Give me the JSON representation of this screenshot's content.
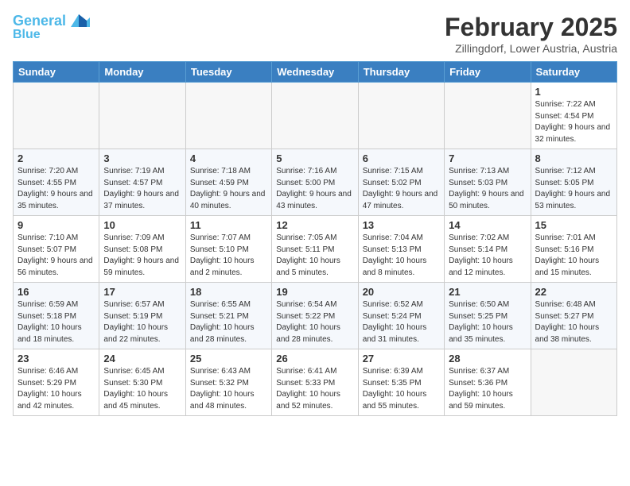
{
  "header": {
    "logo_line1": "General",
    "logo_line2": "Blue",
    "month": "February 2025",
    "location": "Zillingdorf, Lower Austria, Austria"
  },
  "weekdays": [
    "Sunday",
    "Monday",
    "Tuesday",
    "Wednesday",
    "Thursday",
    "Friday",
    "Saturday"
  ],
  "weeks": [
    [
      {
        "day": "",
        "info": ""
      },
      {
        "day": "",
        "info": ""
      },
      {
        "day": "",
        "info": ""
      },
      {
        "day": "",
        "info": ""
      },
      {
        "day": "",
        "info": ""
      },
      {
        "day": "",
        "info": ""
      },
      {
        "day": "1",
        "info": "Sunrise: 7:22 AM\nSunset: 4:54 PM\nDaylight: 9 hours and 32 minutes."
      }
    ],
    [
      {
        "day": "2",
        "info": "Sunrise: 7:20 AM\nSunset: 4:55 PM\nDaylight: 9 hours and 35 minutes."
      },
      {
        "day": "3",
        "info": "Sunrise: 7:19 AM\nSunset: 4:57 PM\nDaylight: 9 hours and 37 minutes."
      },
      {
        "day": "4",
        "info": "Sunrise: 7:18 AM\nSunset: 4:59 PM\nDaylight: 9 hours and 40 minutes."
      },
      {
        "day": "5",
        "info": "Sunrise: 7:16 AM\nSunset: 5:00 PM\nDaylight: 9 hours and 43 minutes."
      },
      {
        "day": "6",
        "info": "Sunrise: 7:15 AM\nSunset: 5:02 PM\nDaylight: 9 hours and 47 minutes."
      },
      {
        "day": "7",
        "info": "Sunrise: 7:13 AM\nSunset: 5:03 PM\nDaylight: 9 hours and 50 minutes."
      },
      {
        "day": "8",
        "info": "Sunrise: 7:12 AM\nSunset: 5:05 PM\nDaylight: 9 hours and 53 minutes."
      }
    ],
    [
      {
        "day": "9",
        "info": "Sunrise: 7:10 AM\nSunset: 5:07 PM\nDaylight: 9 hours and 56 minutes."
      },
      {
        "day": "10",
        "info": "Sunrise: 7:09 AM\nSunset: 5:08 PM\nDaylight: 9 hours and 59 minutes."
      },
      {
        "day": "11",
        "info": "Sunrise: 7:07 AM\nSunset: 5:10 PM\nDaylight: 10 hours and 2 minutes."
      },
      {
        "day": "12",
        "info": "Sunrise: 7:05 AM\nSunset: 5:11 PM\nDaylight: 10 hours and 5 minutes."
      },
      {
        "day": "13",
        "info": "Sunrise: 7:04 AM\nSunset: 5:13 PM\nDaylight: 10 hours and 8 minutes."
      },
      {
        "day": "14",
        "info": "Sunrise: 7:02 AM\nSunset: 5:14 PM\nDaylight: 10 hours and 12 minutes."
      },
      {
        "day": "15",
        "info": "Sunrise: 7:01 AM\nSunset: 5:16 PM\nDaylight: 10 hours and 15 minutes."
      }
    ],
    [
      {
        "day": "16",
        "info": "Sunrise: 6:59 AM\nSunset: 5:18 PM\nDaylight: 10 hours and 18 minutes."
      },
      {
        "day": "17",
        "info": "Sunrise: 6:57 AM\nSunset: 5:19 PM\nDaylight: 10 hours and 22 minutes."
      },
      {
        "day": "18",
        "info": "Sunrise: 6:55 AM\nSunset: 5:21 PM\nDaylight: 10 hours and 28 minutes."
      },
      {
        "day": "19",
        "info": "Sunrise: 6:54 AM\nSunset: 5:22 PM\nDaylight: 10 hours and 28 minutes."
      },
      {
        "day": "20",
        "info": "Sunrise: 6:52 AM\nSunset: 5:24 PM\nDaylight: 10 hours and 31 minutes."
      },
      {
        "day": "21",
        "info": "Sunrise: 6:50 AM\nSunset: 5:25 PM\nDaylight: 10 hours and 35 minutes."
      },
      {
        "day": "22",
        "info": "Sunrise: 6:48 AM\nSunset: 5:27 PM\nDaylight: 10 hours and 38 minutes."
      }
    ],
    [
      {
        "day": "23",
        "info": "Sunrise: 6:46 AM\nSunset: 5:29 PM\nDaylight: 10 hours and 42 minutes."
      },
      {
        "day": "24",
        "info": "Sunrise: 6:45 AM\nSunset: 5:30 PM\nDaylight: 10 hours and 45 minutes."
      },
      {
        "day": "25",
        "info": "Sunrise: 6:43 AM\nSunset: 5:32 PM\nDaylight: 10 hours and 48 minutes."
      },
      {
        "day": "26",
        "info": "Sunrise: 6:41 AM\nSunset: 5:33 PM\nDaylight: 10 hours and 52 minutes."
      },
      {
        "day": "27",
        "info": "Sunrise: 6:39 AM\nSunset: 5:35 PM\nDaylight: 10 hours and 55 minutes."
      },
      {
        "day": "28",
        "info": "Sunrise: 6:37 AM\nSunset: 5:36 PM\nDaylight: 10 hours and 59 minutes."
      },
      {
        "day": "",
        "info": ""
      }
    ]
  ]
}
